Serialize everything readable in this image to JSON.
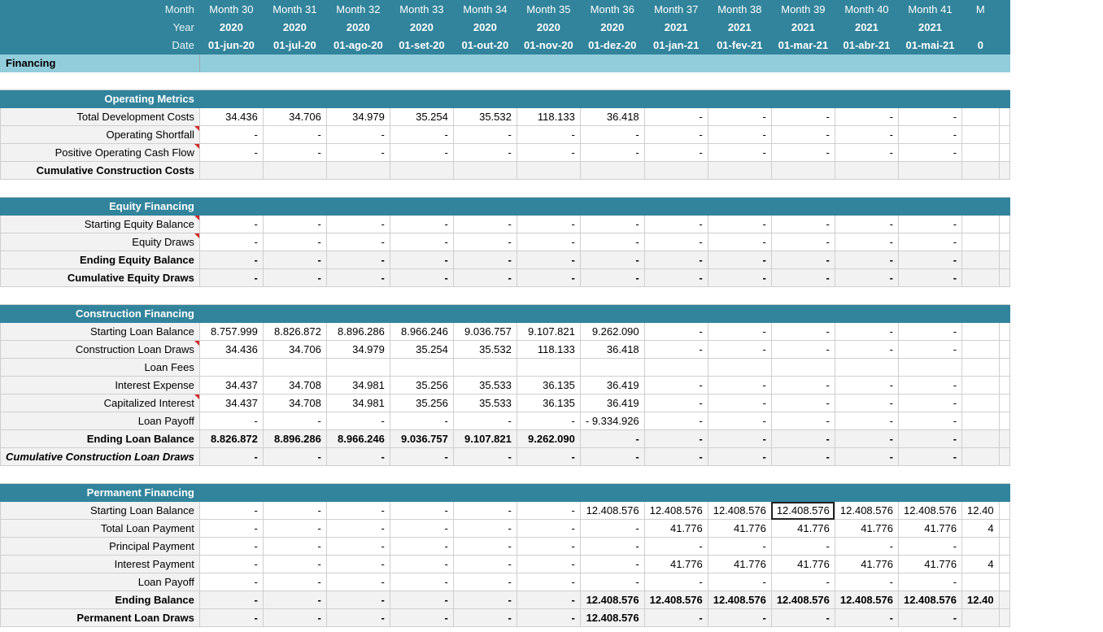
{
  "header": {
    "month_label": "Month",
    "year_label": "Year",
    "date_label": "Date",
    "months": [
      "Month 30",
      "Month 31",
      "Month 32",
      "Month 33",
      "Month 34",
      "Month 35",
      "Month 36",
      "Month 37",
      "Month 38",
      "Month 39",
      "Month 40",
      "Month 41",
      "M"
    ],
    "years": [
      "2020",
      "2020",
      "2020",
      "2020",
      "2020",
      "2020",
      "2020",
      "2021",
      "2021",
      "2021",
      "2021",
      "2021",
      ""
    ],
    "dates": [
      "01-jun-20",
      "01-jul-20",
      "01-ago-20",
      "01-set-20",
      "01-out-20",
      "01-nov-20",
      "01-dez-20",
      "01-jan-21",
      "01-fev-21",
      "01-mar-21",
      "01-abr-21",
      "01-mai-21",
      "0"
    ]
  },
  "financing_title": "Financing",
  "sections": [
    {
      "title": "Operating Metrics",
      "rows": [
        {
          "label": "Total Development Costs",
          "values": [
            "34.436",
            "34.706",
            "34.979",
            "35.254",
            "35.532",
            "118.133",
            "36.418",
            "-",
            "-",
            "-",
            "-",
            "-",
            ""
          ]
        },
        {
          "label": "Operating Shortfall",
          "values": [
            "-",
            "-",
            "-",
            "-",
            "-",
            "-",
            "-",
            "-",
            "-",
            "-",
            "-",
            "-",
            ""
          ]
        },
        {
          "label": "Positive Operating Cash Flow",
          "values": [
            "-",
            "-",
            "-",
            "-",
            "-",
            "-",
            "-",
            "-",
            "-",
            "-",
            "-",
            "-",
            ""
          ]
        },
        {
          "label": "Cumulative Construction Costs",
          "values": [
            "",
            "",
            "",
            "",
            "",
            "",
            "",
            "",
            "",
            "",
            "",
            "",
            ""
          ]
        }
      ]
    },
    {
      "title": "Equity Financing",
      "rows": [
        {
          "label": "Starting Equity Balance",
          "values": [
            "-",
            "-",
            "-",
            "-",
            "-",
            "-",
            "-",
            "-",
            "-",
            "-",
            "-",
            "-",
            ""
          ]
        },
        {
          "label": "Equity Draws",
          "values": [
            "-",
            "-",
            "-",
            "-",
            "-",
            "-",
            "-",
            "-",
            "-",
            "-",
            "-",
            "-",
            ""
          ]
        },
        {
          "label": "Ending Equity Balance",
          "values": [
            "-",
            "-",
            "-",
            "-",
            "-",
            "-",
            "-",
            "-",
            "-",
            "-",
            "-",
            "-",
            ""
          ]
        },
        {
          "label": "Cumulative Equity Draws",
          "values": [
            "-",
            "-",
            "-",
            "-",
            "-",
            "-",
            "-",
            "-",
            "-",
            "-",
            "-",
            "-",
            ""
          ]
        }
      ]
    },
    {
      "title": "Construction Financing",
      "rows": [
        {
          "label": "Starting Loan Balance",
          "values": [
            "8.757.999",
            "8.826.872",
            "8.896.286",
            "8.966.246",
            "9.036.757",
            "9.107.821",
            "9.262.090",
            "-",
            "-",
            "-",
            "-",
            "-",
            ""
          ]
        },
        {
          "label": "Construction Loan Draws",
          "values": [
            "34.436",
            "34.706",
            "34.979",
            "35.254",
            "35.532",
            "118.133",
            "36.418",
            "-",
            "-",
            "-",
            "-",
            "-",
            ""
          ]
        },
        {
          "label": "Loan Fees",
          "values": [
            "",
            "",
            "",
            "",
            "",
            "",
            "",
            "",
            "",
            "",
            "",
            "",
            ""
          ]
        },
        {
          "label": "Interest Expense",
          "values": [
            "34.437",
            "34.708",
            "34.981",
            "35.256",
            "35.533",
            "36.135",
            "36.419",
            "-",
            "-",
            "-",
            "-",
            "-",
            ""
          ]
        },
        {
          "label": "Capitalized Interest",
          "values": [
            "34.437",
            "34.708",
            "34.981",
            "35.256",
            "35.533",
            "36.135",
            "36.419",
            "-",
            "-",
            "-",
            "-",
            "-",
            ""
          ]
        },
        {
          "label": "Loan Payoff",
          "values": [
            "-",
            "-",
            "-",
            "-",
            "-",
            "-",
            "- 9.334.926",
            "-",
            "-",
            "-",
            "-",
            "-",
            ""
          ]
        },
        {
          "label": "Ending Loan Balance",
          "values": [
            "8.826.872",
            "8.896.286",
            "8.966.246",
            "9.036.757",
            "9.107.821",
            "9.262.090",
            "-",
            "-",
            "-",
            "-",
            "-",
            "-",
            ""
          ]
        },
        {
          "label": "Cumulative Construction Loan Draws",
          "values": [
            "-",
            "-",
            "-",
            "-",
            "-",
            "-",
            "-",
            "-",
            "-",
            "-",
            "-",
            "-",
            ""
          ]
        }
      ]
    },
    {
      "title": "Permanent Financing",
      "rows": [
        {
          "label": "Starting Loan Balance",
          "values": [
            "-",
            "-",
            "-",
            "-",
            "-",
            "-",
            "12.408.576",
            "12.408.576",
            "12.408.576",
            "12.408.576",
            "12.408.576",
            "12.408.576",
            "12.40"
          ]
        },
        {
          "label": "Total Loan Payment",
          "values": [
            "-",
            "-",
            "-",
            "-",
            "-",
            "-",
            "-",
            "41.776",
            "41.776",
            "41.776",
            "41.776",
            "41.776",
            "4"
          ]
        },
        {
          "label": "Principal Payment",
          "values": [
            "-",
            "-",
            "-",
            "-",
            "-",
            "-",
            "-",
            "-",
            "-",
            "-",
            "-",
            "-",
            ""
          ]
        },
        {
          "label": "Interest Payment",
          "values": [
            "-",
            "-",
            "-",
            "-",
            "-",
            "-",
            "-",
            "41.776",
            "41.776",
            "41.776",
            "41.776",
            "41.776",
            "4"
          ]
        },
        {
          "label": "Loan Payoff",
          "values": [
            "-",
            "-",
            "-",
            "-",
            "-",
            "-",
            "-",
            "-",
            "-",
            "-",
            "-",
            "-",
            ""
          ]
        },
        {
          "label": "Ending Balance",
          "values": [
            "-",
            "-",
            "-",
            "-",
            "-",
            "-",
            "12.408.576",
            "12.408.576",
            "12.408.576",
            "12.408.576",
            "12.408.576",
            "12.408.576",
            "12.40"
          ]
        },
        {
          "label": "Permanent Loan Draws",
          "values": [
            "-",
            "-",
            "-",
            "-",
            "-",
            "-",
            "12.408.576",
            "-",
            "-",
            "-",
            "-",
            "-",
            ""
          ]
        }
      ]
    }
  ]
}
